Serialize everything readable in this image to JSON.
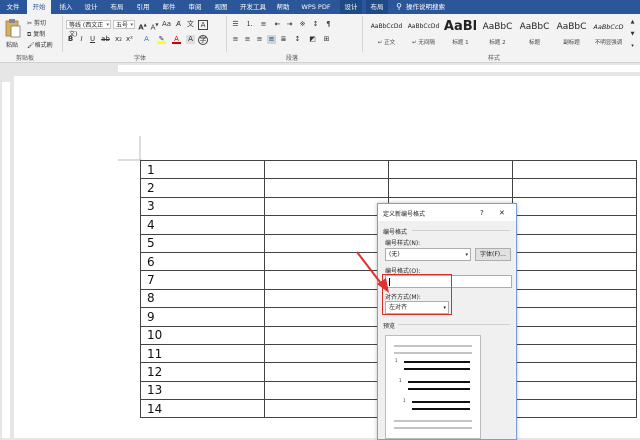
{
  "tabs": [
    {
      "label": "文件",
      "active": false
    },
    {
      "label": "开始",
      "active": true
    },
    {
      "label": "插入",
      "active": false
    },
    {
      "label": "设计",
      "active": false
    },
    {
      "label": "布局",
      "active": false
    },
    {
      "label": "引用",
      "active": false
    },
    {
      "label": "邮件",
      "active": false
    },
    {
      "label": "审阅",
      "active": false
    },
    {
      "label": "视图",
      "active": false
    },
    {
      "label": "开发工具",
      "active": false
    },
    {
      "label": "帮助",
      "active": false
    },
    {
      "label": "WPS PDF",
      "active": false
    },
    {
      "label": "设计",
      "active": false
    },
    {
      "label": "布局",
      "active": false
    }
  ],
  "tellme": "操作说明搜索",
  "clipboard": {
    "paste": "粘贴",
    "cut": "剪切",
    "copy": "复制",
    "format_painter": "格式刷",
    "group": "剪贴板"
  },
  "font": {
    "name": "等线 (西文正文)",
    "size": "五号",
    "group": "字体"
  },
  "paragraph": {
    "group": "段落"
  },
  "styles": {
    "group": "样式",
    "items": [
      {
        "preview": "AaBbCcDd",
        "name": "↵ 正文"
      },
      {
        "preview": "AaBbCcDd",
        "name": "↵ 无间隔"
      },
      {
        "preview": "AaBl",
        "name": "标题 1"
      },
      {
        "preview": "AaBbC",
        "name": "标题 2"
      },
      {
        "preview": "AaBbC",
        "name": "标题"
      },
      {
        "preview": "AaBbC",
        "name": "副标题"
      },
      {
        "preview": "AaBbCcD",
        "name": "不明显强调"
      }
    ]
  },
  "table": {
    "rows": [
      "1",
      "2",
      "3",
      "4",
      "5",
      "6",
      "7",
      "8",
      "9",
      "10",
      "11",
      "12",
      "13",
      "14"
    ]
  },
  "dialog": {
    "title": "定义新编号格式",
    "help": "?",
    "close": "✕",
    "section_format": "编号格式",
    "style_label": "编号样式(N):",
    "style_value": "(无)",
    "font_button": "字体(F)...",
    "format_label": "编号格式(O):",
    "format_value": "",
    "align_label": "对齐方式(M):",
    "align_value": "左对齐",
    "preview_label": "预览"
  }
}
